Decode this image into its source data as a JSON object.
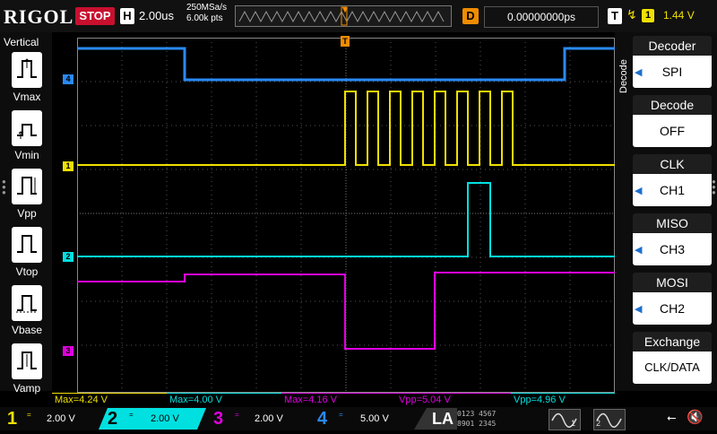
{
  "top": {
    "logo": "RIGOL",
    "run_state": "STOP",
    "horizontal_label": "H",
    "timebase": "2.00us",
    "sample_rate": "250MSa/s",
    "memory_depth": "6.00k pts",
    "delay_label": "D",
    "delay_value": "0.00000000ps",
    "trigger_label": "T",
    "trigger_edge": "↯",
    "trigger_source": "1",
    "trigger_level": "1.44 V"
  },
  "left_panel": {
    "title": "Vertical",
    "buttons": [
      "Vmax",
      "Vmin",
      "Vpp",
      "Vtop",
      "Vbase",
      "Vamp"
    ]
  },
  "right_panel": {
    "tab_label": "Decode",
    "items": [
      {
        "label": "Decoder",
        "value": "SPI",
        "arrow": true
      },
      {
        "label": "Decode",
        "value": "OFF",
        "arrow": false
      },
      {
        "label": "CLK",
        "value": "CH1",
        "arrow": true
      },
      {
        "label": "MISO",
        "value": "CH3",
        "arrow": true
      },
      {
        "label": "MOSI",
        "value": "CH2",
        "arrow": true
      },
      {
        "label": "Exchange",
        "value": "CLK/DATA",
        "arrow": false
      }
    ]
  },
  "markers": {
    "ch4": "4",
    "ch1": "1",
    "ch2": "2",
    "ch3": "3",
    "trigger_top": "T",
    "trigger_level": "T"
  },
  "measurements": [
    {
      "text": "Max=4.24 V",
      "color": "#f0e000"
    },
    {
      "text": "Max=4.00 V",
      "color": "#00e0e0"
    },
    {
      "text": "Max=4.16 V",
      "color": "#e000e0"
    },
    {
      "text": "Vpp=5.04 V",
      "color": "#e000e0"
    },
    {
      "text": "Vpp=4.96 V",
      "color": "#00e0e0"
    }
  ],
  "channels": [
    {
      "num": "1",
      "coupling": "=",
      "scale": "2.00 V",
      "color": "#f0e000"
    },
    {
      "num": "2",
      "coupling": "=",
      "scale": "2.00 V",
      "color": "#00e0e0"
    },
    {
      "num": "3",
      "coupling": "=",
      "scale": "2.00 V",
      "color": "#e000e0"
    },
    {
      "num": "4",
      "coupling": "=",
      "scale": "5.00 V",
      "color": "#2a8af5"
    }
  ],
  "bottom": {
    "la_label": "LA",
    "digital_top": "0123 4567",
    "digital_bottom": "8901 2345",
    "wave_btn_1": "1",
    "wave_btn_2": "2"
  },
  "colors": {
    "ch1": "#f0e000",
    "ch2": "#00e0e0",
    "ch3": "#e000e0",
    "ch4": "#2a8af5",
    "trigger": "#f08c00",
    "stop": "#c8102e"
  }
}
